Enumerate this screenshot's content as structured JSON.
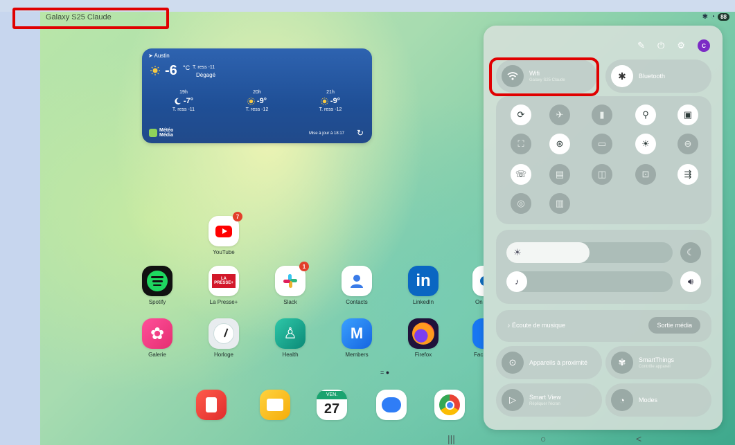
{
  "status_bar": {
    "device_name": "Galaxy S25 Claude",
    "battery": "88"
  },
  "weather": {
    "city": "Austin",
    "current_temp": "-6",
    "unit": "°C",
    "feels_like": "T. ress -11",
    "condition": "Dégagé",
    "forecast": [
      {
        "hour": "19h",
        "temp": "-7°",
        "feels": "T. ress -11",
        "icon": "moon-icon"
      },
      {
        "hour": "20h",
        "temp": "-9°",
        "feels": "T. ress -12",
        "icon": "sun-icon"
      },
      {
        "hour": "21h",
        "temp": "-9°",
        "feels": "T. ress -12",
        "icon": "sun-icon"
      }
    ],
    "brand_line1": "Météo",
    "brand_line2": "Média",
    "updated": "Mise à jour à 18:17"
  },
  "apps": {
    "youtube": {
      "label": "YouTube",
      "badge": "7"
    },
    "spotify": {
      "label": "Spotify"
    },
    "lapresse": {
      "label": "La Presse+",
      "icon_text": "LA PRESSE+"
    },
    "slack": {
      "label": "Slack",
      "badge": "1"
    },
    "contacts": {
      "label": "Contacts"
    },
    "linkedin": {
      "label": "LinkedIn",
      "icon_text": "in"
    },
    "onedrive": {
      "label": "On"
    },
    "galerie": {
      "label": "Galerie"
    },
    "horloge": {
      "label": "Horloge"
    },
    "health": {
      "label": "Health"
    },
    "members": {
      "label": "Members",
      "icon_text": "M"
    },
    "firefox": {
      "label": "Firefox"
    },
    "facebook": {
      "label": "Fac"
    }
  },
  "dock": {
    "calendar_day": "VEN.",
    "calendar_date": "27"
  },
  "quick_panel": {
    "avatar_letter": "C",
    "wifi": {
      "title": "Wifi",
      "subtitle": "Galaxy S25 Claude"
    },
    "bluetooth": {
      "title": "Bluetooth"
    },
    "media_title": "Écoute de musique",
    "media_output": "Sortie média",
    "nearby": {
      "title": "Appareils à proximité"
    },
    "smartthings": {
      "title": "SmartThings",
      "subtitle": "Contrôle appareil"
    },
    "smartview": {
      "title": "Smart View",
      "subtitle": "Répliquer l'écran"
    },
    "modes": {
      "title": "Modes"
    },
    "brightness_level": 0.5,
    "volume_level": 0.0
  },
  "colors": {
    "highlight": "#e00000",
    "panel_bg": "#d6e0da",
    "weather_bg": "#2457a3",
    "avatar": "#7b2bc5"
  }
}
